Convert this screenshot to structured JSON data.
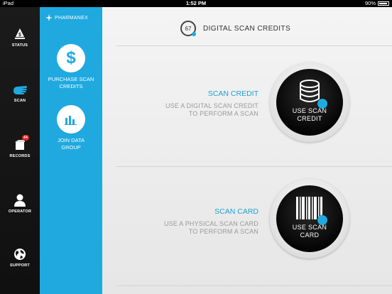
{
  "status_bar": {
    "carrier": "iPad",
    "time": "1:52 PM",
    "battery": "90%",
    "battery_level": 0.9
  },
  "sidebar": {
    "items": [
      {
        "label": "STATUS",
        "icon": "status-icon"
      },
      {
        "label": "SCAN",
        "icon": "hand-scan-icon",
        "active": true
      },
      {
        "label": "RECORDS",
        "icon": "records-icon",
        "badge": "44"
      },
      {
        "label": "OPERATOR",
        "icon": "person-icon"
      },
      {
        "label": "SUPPORT",
        "icon": "globe-icon"
      }
    ]
  },
  "subnav": {
    "brand": "PHARMANEX",
    "items": [
      {
        "label": "PURCHASE SCAN CREDITS",
        "icon": "dollar-icon"
      },
      {
        "label": "JOIN DATA GROUP",
        "icon": "bar-chart-icon"
      }
    ]
  },
  "header": {
    "count": "67",
    "title": "DIGITAL SCAN CREDITS"
  },
  "options": [
    {
      "title": "SCAN CREDIT",
      "subtitle_line1": "USE A DIGITAL SCAN CREDIT",
      "subtitle_line2": "TO PERFORM A SCAN",
      "button_line1": "USE SCAN",
      "button_line2": "CREDIT",
      "button_icon": "coin-stack-icon"
    },
    {
      "title": "SCAN CARD",
      "subtitle_line1": "USE A PHYSICAL SCAN CARD",
      "subtitle_line2": "TO PERFORM A SCAN",
      "button_line1": "USE SCAN",
      "button_line2": "CARD",
      "button_icon": "barcode-icon"
    }
  ],
  "colors": {
    "accent": "#1fa9df",
    "sidebar": "#151515",
    "button": "#000000"
  }
}
